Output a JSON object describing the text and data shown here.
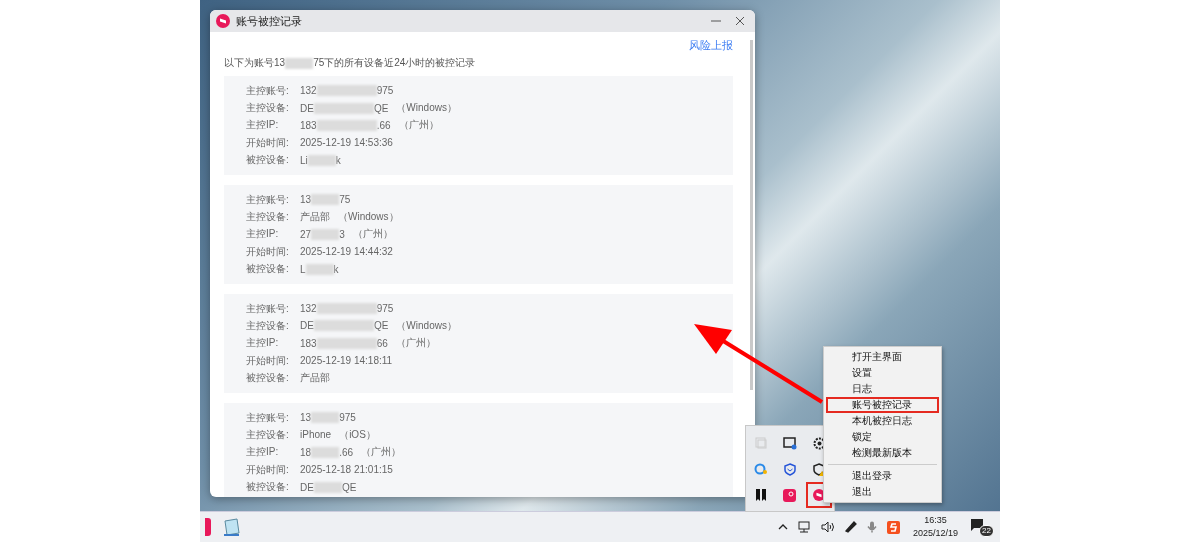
{
  "window": {
    "title": "账号被控记录",
    "report_link": "风险上报",
    "intro": {
      "parts": [
        "以下为账号13",
        "75下的所有设备近24小时的被控记录"
      ]
    },
    "records": [
      {
        "fields": [
          {
            "label": "主控账号:",
            "parts": [
              "132",
              "975"
            ]
          },
          {
            "label": "主控设备:",
            "parts": [
              "DE",
              "QE"
            ],
            "note": "（Windows）"
          },
          {
            "label": "主控IP:",
            "parts": [
              "183",
              ".66"
            ],
            "note": "（广州）"
          },
          {
            "label": "开始时间:",
            "parts": [
              "2025-12-19 14:53:36"
            ]
          },
          {
            "label": "被控设备:",
            "parts": [
              "Li",
              "k"
            ]
          }
        ]
      },
      {
        "fields": [
          {
            "label": "主控账号:",
            "parts": [
              "13",
              "75"
            ]
          },
          {
            "label": "主控设备:",
            "parts": [
              "产品部"
            ],
            "note": "（Windows）"
          },
          {
            "label": "主控IP:",
            "parts": [
              "27",
              "3"
            ],
            "note": "（广州）"
          },
          {
            "label": "开始时间:",
            "parts": [
              "2025-12-19 14:44:32"
            ]
          },
          {
            "label": "被控设备:",
            "parts": [
              "L",
              "k"
            ]
          }
        ]
      },
      {
        "fields": [
          {
            "label": "主控账号:",
            "parts": [
              "132",
              "975"
            ]
          },
          {
            "label": "主控设备:",
            "parts": [
              "DE",
              "QE"
            ],
            "note": "（Windows）"
          },
          {
            "label": "主控IP:",
            "parts": [
              "183",
              "66"
            ],
            "note": "（广州）"
          },
          {
            "label": "开始时间:",
            "parts": [
              "2025-12-19 14:18:11"
            ]
          },
          {
            "label": "被控设备:",
            "parts": [
              "产品部"
            ]
          }
        ]
      },
      {
        "fields": [
          {
            "label": "主控账号:",
            "parts": [
              "13",
              "975"
            ]
          },
          {
            "label": "主控设备:",
            "parts": [
              "iPhone"
            ],
            "note": "（iOS）"
          },
          {
            "label": "主控IP:",
            "parts": [
              "18",
              ".66"
            ],
            "note": "（广州）"
          },
          {
            "label": "开始时间:",
            "parts": [
              "2025-12-18 21:01:15"
            ]
          },
          {
            "label": "被控设备:",
            "parts": [
              "DE",
              "QE"
            ]
          }
        ]
      }
    ]
  },
  "context_menu": {
    "groups": [
      [
        {
          "label": "打开主界面",
          "highlighted": false
        },
        {
          "label": "设置",
          "highlighted": false
        },
        {
          "label": "日志",
          "highlighted": false
        },
        {
          "label": "账号被控记录",
          "highlighted": true
        },
        {
          "label": "本机被控日志",
          "highlighted": false
        },
        {
          "label": "锁定",
          "highlighted": false
        },
        {
          "label": "检测最新版本",
          "highlighted": false
        }
      ],
      [
        {
          "label": "退出登录",
          "highlighted": false
        },
        {
          "label": "退出",
          "highlighted": false
        }
      ]
    ]
  },
  "taskbar": {
    "time": "16:35",
    "date": "2025/12/19",
    "notification_count": "22"
  }
}
